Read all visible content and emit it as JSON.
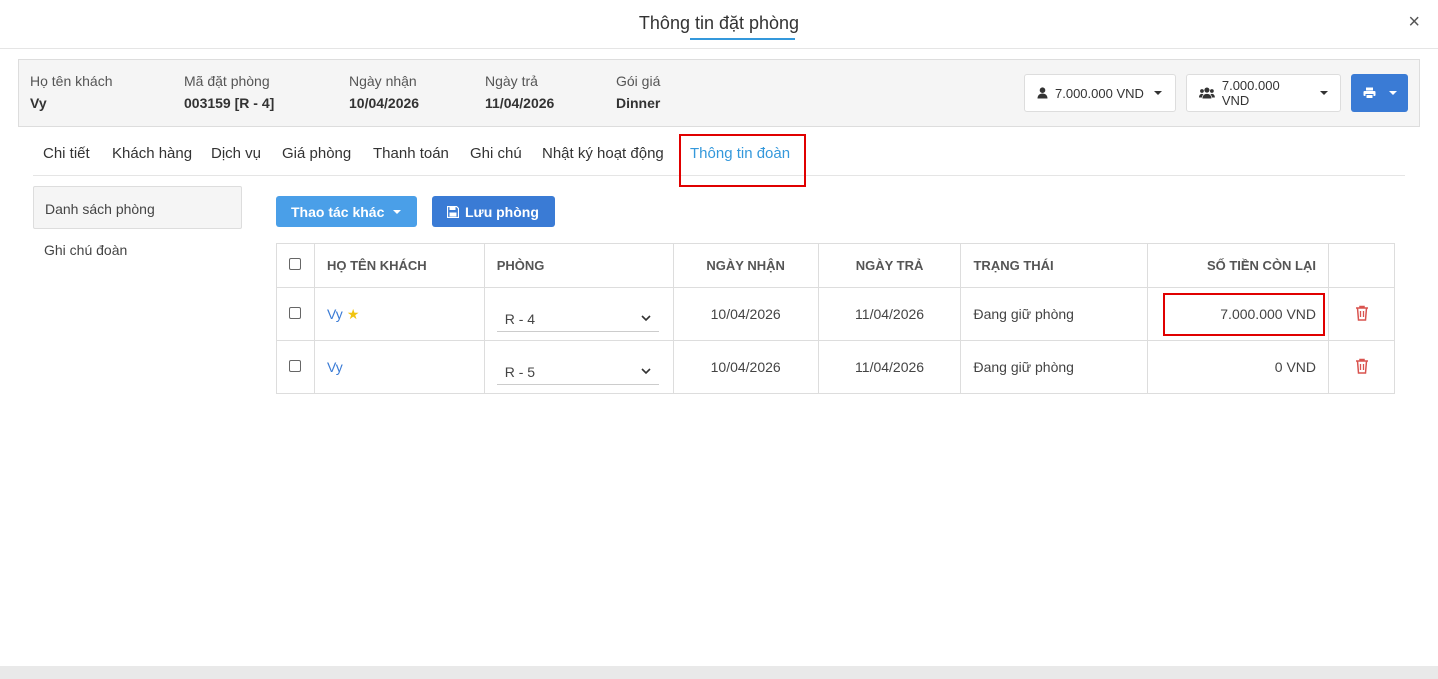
{
  "modal": {
    "title": "Thông tin đặt phòng",
    "close": "×"
  },
  "info": [
    {
      "label": "Họ tên khách",
      "value": "Vy"
    },
    {
      "label": "Mã đặt phòng",
      "value": "003159 [R - 4]"
    },
    {
      "label": "Ngày nhận",
      "value": "10/04/2026"
    },
    {
      "label": "Ngày trả",
      "value": "11/04/2026"
    },
    {
      "label": "Gói giá",
      "value": "Dinner"
    }
  ],
  "balance_buttons": [
    {
      "label": "7.000.000 VND",
      "icon": "user-icon"
    },
    {
      "label": "7.000.000 VND",
      "icon": "users-icon"
    }
  ],
  "tabs": [
    "Chi tiết",
    "Khách hàng",
    "Dịch vụ",
    "Giá phòng",
    "Thanh toán",
    "Ghi chú",
    "Nhật ký hoạt động",
    "Thông tin đoàn"
  ],
  "active_tab": "Thông tin đoàn",
  "sidebar": [
    "Danh sách phòng",
    "Ghi chú đoàn"
  ],
  "actions": {
    "more": "Thao tác khác",
    "save": "Lưu phòng"
  },
  "table": {
    "headers": [
      "HỌ TÊN KHÁCH",
      "PHÒNG",
      "NGÀY NHẬN",
      "NGÀY TRẢ",
      "TRẠNG THÁI",
      "SỐ TIỀN CÒN LẠI"
    ],
    "rows": [
      {
        "guest": "Vy",
        "room": "R - 4",
        "checkin": "10/04/2026",
        "checkout": "11/04/2026",
        "status": "Đang giữ phòng",
        "balance": "7.000.000 VND",
        "starred": true
      },
      {
        "guest": "Vy",
        "room": "R - 5",
        "checkin": "10/04/2026",
        "checkout": "11/04/2026",
        "status": "Đang giữ phòng",
        "balance": "0 VND",
        "starred": false
      }
    ]
  },
  "colors": {
    "accent": "#3498db",
    "primary_button": "#3a7bd5",
    "highlight": "#e00000",
    "delete": "#d9534f"
  }
}
